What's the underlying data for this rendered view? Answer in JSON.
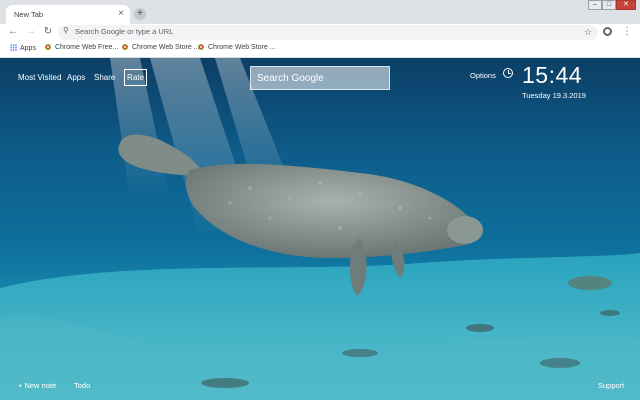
{
  "browser": {
    "tab_title": "New Tab",
    "tab_close": "×",
    "new_tab": "+",
    "omnibox_placeholder": "Search Google or type a URL",
    "window_controls": {
      "minimize": "–",
      "maximize": "□",
      "close": "✕"
    }
  },
  "bookmarks": [
    {
      "label": "Apps",
      "icon": "apps-grid-icon"
    },
    {
      "label": "Chrome Web Free..."
    },
    {
      "label": "Chrome Web Store ..."
    },
    {
      "label": "Chrome Web Store ..."
    }
  ],
  "newtab": {
    "links_left": [
      "Most Visited",
      "Apps",
      "Share",
      "Rate"
    ],
    "search_placeholder": "Search Google",
    "options": "Options",
    "time": "15:44",
    "date": "Tuesday  19.3.2019",
    "bottom_left": [
      "+ New note",
      "Todo"
    ],
    "bottom_right": "Support",
    "background": "underwater manatee photo"
  },
  "colors": {
    "chrome_bg": "#dee1e6",
    "water_deep": "#0b3f66",
    "water_light": "#2ea1b8",
    "text_white": "#ffffff"
  }
}
